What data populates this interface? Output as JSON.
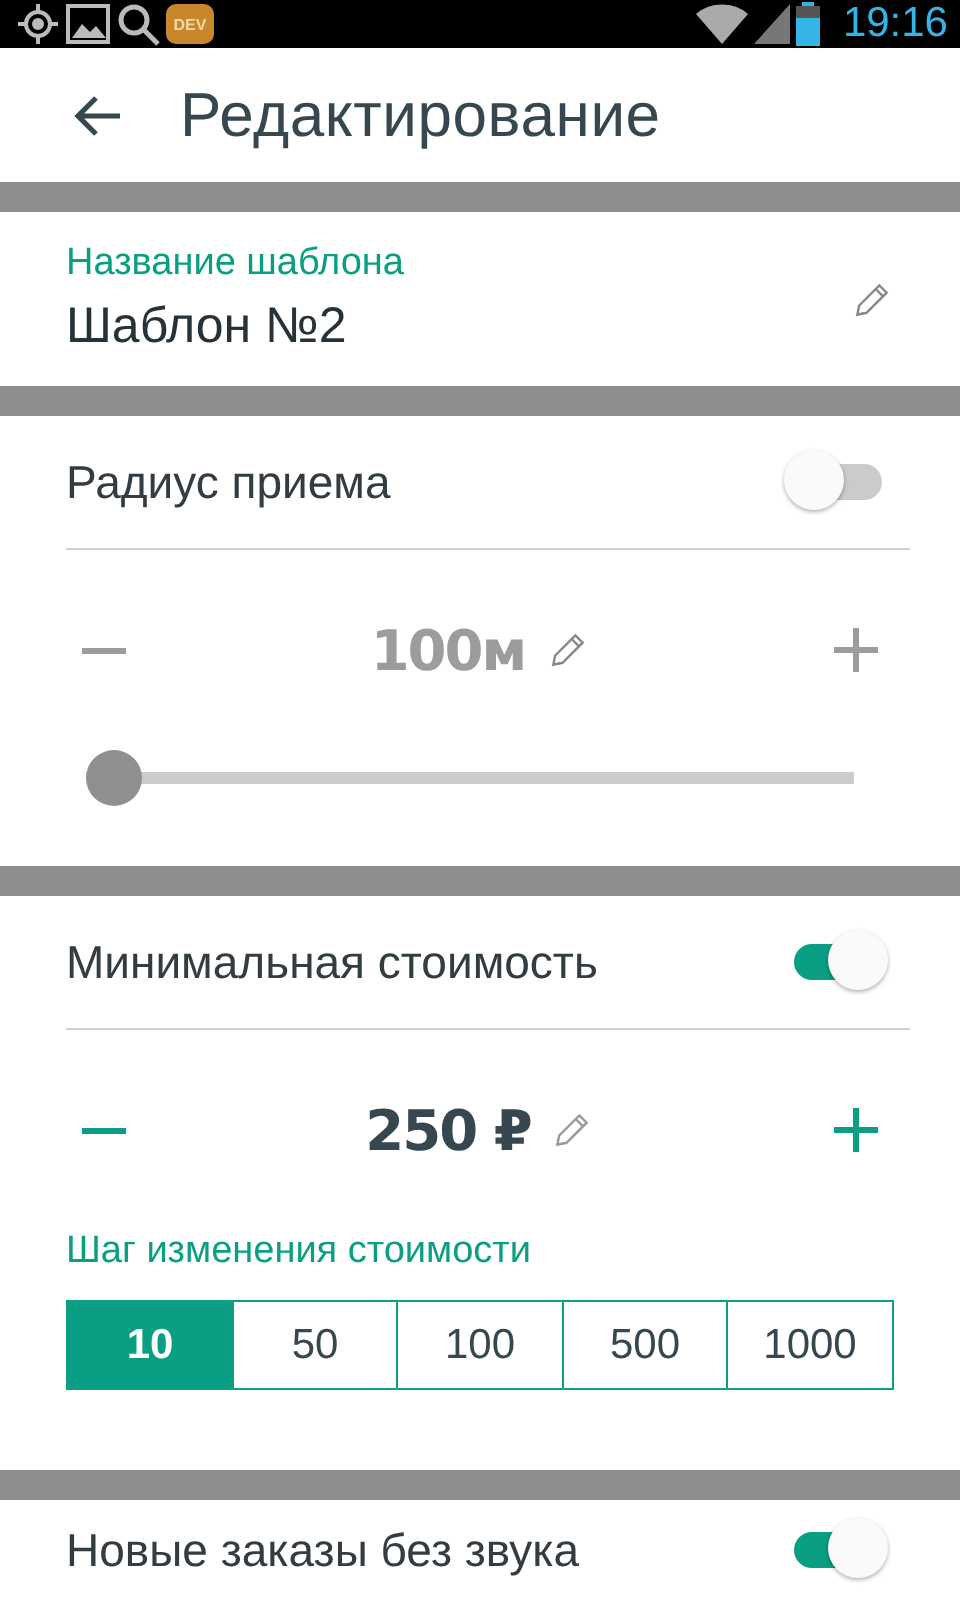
{
  "status_bar": {
    "badge": "DEV",
    "time": "19:16"
  },
  "toolbar": {
    "title": "Редактирование"
  },
  "template_name": {
    "label": "Название шаблона",
    "value": "Шаблон №2"
  },
  "radius": {
    "label": "Радиус приема",
    "on": false,
    "stepper": {
      "value": "100м",
      "disabled": true
    },
    "slider": {
      "level": 0
    }
  },
  "min_cost": {
    "label": "Минимальная стоимость",
    "on": true,
    "stepper": {
      "value": "250 ₽",
      "disabled": false
    },
    "step_label": "Шаг изменения стоимости",
    "steps": [
      {
        "label": "10",
        "selected": true
      },
      {
        "label": "50",
        "selected": false
      },
      {
        "label": "100",
        "selected": false
      },
      {
        "label": "500",
        "selected": false
      },
      {
        "label": "1000",
        "selected": false
      }
    ]
  },
  "silent_orders": {
    "label": "Новые заказы без звука",
    "on": true
  }
}
